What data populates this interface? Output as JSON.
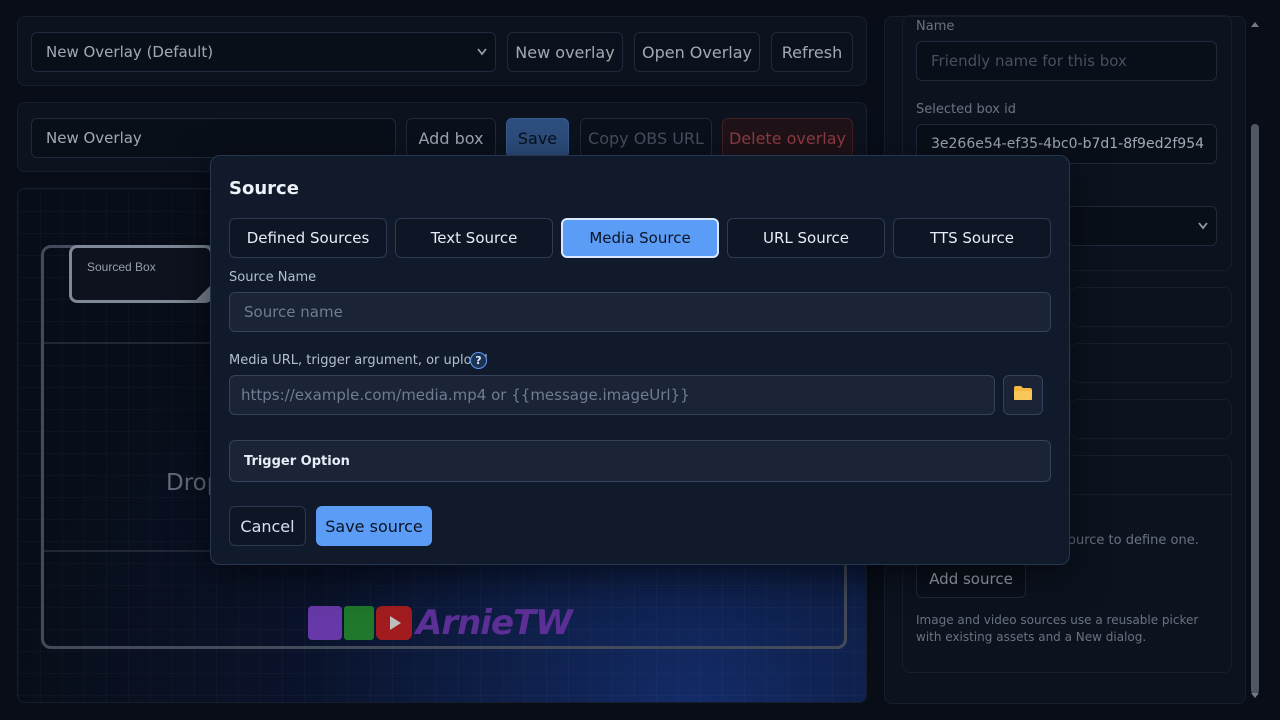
{
  "toolbar": {
    "overlay_select": "New Overlay (Default)",
    "new_overlay": "New overlay",
    "open_overlay": "Open Overlay",
    "refresh": "Refresh"
  },
  "editor": {
    "overlay_name": "New Overlay",
    "add_box": "Add box",
    "save": "Save",
    "copy_obs_url": "Copy OBS URL",
    "delete_overlay": "Delete overlay"
  },
  "preview": {
    "sourced_box_label": "Sourced Box",
    "drop_text": "Drop",
    "logo_text": "ArnieTW"
  },
  "sidebar": {
    "name_label": "Name",
    "name_placeholder": "Friendly name for this box",
    "selected_box_label": "Selected box id",
    "selected_box_value": "3e266e54-ef35-4bc0-b7d1-8f9ed2f954",
    "source_hint": "ource to define one.",
    "add_source": "Add source",
    "footer_note": "Image and video sources use a reusable picker with existing assets and a New dialog."
  },
  "modal": {
    "title": "Source",
    "tabs": [
      {
        "label": "Defined Sources"
      },
      {
        "label": "Text Source"
      },
      {
        "label": "Media Source"
      },
      {
        "label": "URL Source"
      },
      {
        "label": "TTS Source"
      }
    ],
    "source_name_label": "Source Name",
    "source_name_placeholder": "Source name",
    "media_label": "Media URL, trigger argument, or upload",
    "media_placeholder": "https://example.com/media.mp4 or {{message.imageUrl}}",
    "trigger_option": "Trigger Option",
    "cancel": "Cancel",
    "save_source": "Save source"
  },
  "colors": {
    "accent": "#5b9cf6",
    "background": "#0b1220",
    "panel": "#111a2a",
    "delete": "#c0505a"
  },
  "icons": {
    "help": "question-circle-icon",
    "folder": "folder-icon",
    "dropdown": "chevron-down-icon"
  }
}
